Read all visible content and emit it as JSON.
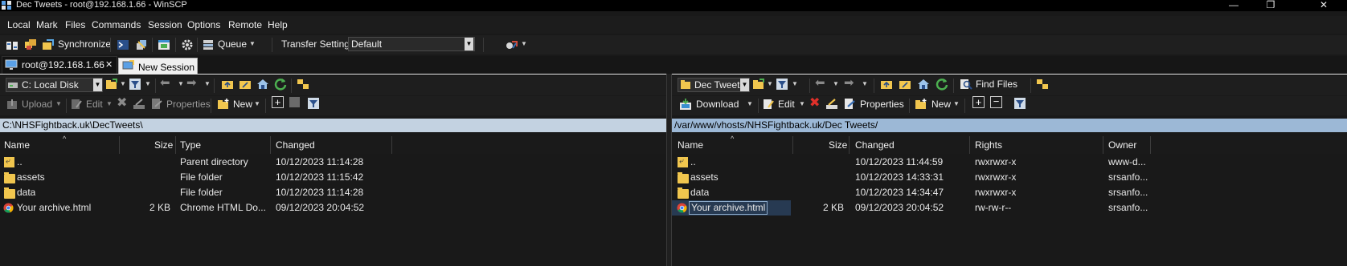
{
  "window": {
    "title": "Dec Tweets - root@192.168.1.66 - WinSCP",
    "controls": {
      "minimize": "—",
      "restore": "❐",
      "close": "✕"
    }
  },
  "menu": [
    "Local",
    "Mark",
    "Files",
    "Commands",
    "Session",
    "Options",
    "Remote",
    "Help"
  ],
  "toolbar": {
    "synchronize_label": "Synchronize",
    "queue_label": "Queue",
    "transfer_settings_label": "Transfer Settings",
    "transfer_settings_value": "Default"
  },
  "tabs": [
    {
      "label": "root@192.168.1.66",
      "close": "✕",
      "icon": "monitor-icon"
    },
    {
      "label": "New Session",
      "icon": "new-session-icon"
    }
  ],
  "left_panel": {
    "drive": "C: Local Disk",
    "actions": {
      "upload": "Upload",
      "edit": "Edit",
      "properties": "Properties",
      "new": "New"
    },
    "path": "C:\\NHSFightback.uk\\DecTweets\\",
    "columns": [
      "Name",
      "Size",
      "Type",
      "Changed"
    ],
    "rows": [
      {
        "name": "..",
        "size": "",
        "type": "Parent directory",
        "changed": "10/12/2023  11:14:28",
        "icon": "parent-dir-icon"
      },
      {
        "name": "assets",
        "size": "",
        "type": "File folder",
        "changed": "10/12/2023  11:15:42",
        "icon": "folder-icon"
      },
      {
        "name": "data",
        "size": "",
        "type": "File folder",
        "changed": "10/12/2023  11:14:28",
        "icon": "folder-icon"
      },
      {
        "name": "Your archive.html",
        "size": "2 KB",
        "type": "Chrome HTML Do...",
        "changed": "09/12/2023  20:04:52",
        "icon": "chrome-icon"
      }
    ]
  },
  "right_panel": {
    "drive": "Dec Tweet",
    "actions": {
      "download": "Download",
      "edit": "Edit",
      "properties": "Properties",
      "new": "New",
      "find_files": "Find Files"
    },
    "path": "/var/www/vhosts/NHSFightback.uk/Dec Tweets/",
    "columns": [
      "Name",
      "Size",
      "Changed",
      "Rights",
      "Owner"
    ],
    "rows": [
      {
        "name": "..",
        "size": "",
        "changed": "10/12/2023  11:44:59",
        "rights": "rwxrwxr-x",
        "owner": "www-d...",
        "icon": "parent-dir-icon"
      },
      {
        "name": "assets",
        "size": "",
        "changed": "10/12/2023  14:33:31",
        "rights": "rwxrwxr-x",
        "owner": "srsanfo...",
        "icon": "folder-icon"
      },
      {
        "name": "data",
        "size": "",
        "changed": "10/12/2023  14:34:47",
        "rights": "rwxrwxr-x",
        "owner": "srsanfo...",
        "icon": "folder-icon"
      },
      {
        "name": "Your archive.html",
        "size": "2 KB",
        "changed": "09/12/2023  20:04:52",
        "rights": "rw-rw-r--",
        "owner": "srsanfo...",
        "icon": "chrome-icon"
      }
    ]
  },
  "colors": {
    "background": "#191919",
    "path_left": "#c3d2e1",
    "path_right": "#9cb8d6",
    "folder": "#f1c64e",
    "selection": "#273a52"
  }
}
